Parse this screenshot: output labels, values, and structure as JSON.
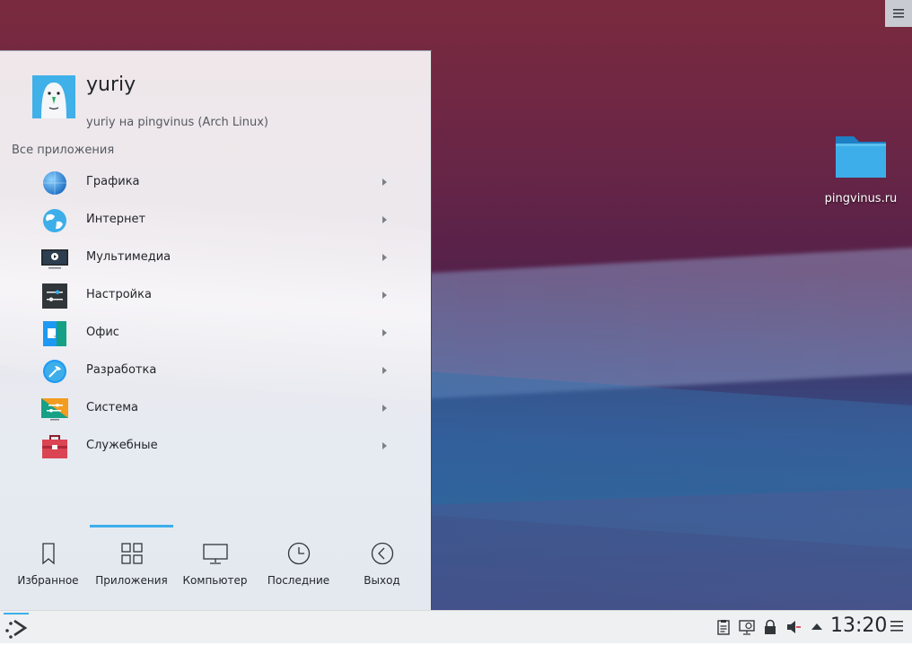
{
  "desktop": {
    "icons": [
      {
        "label": "pingvinus.ru",
        "icon": "folder-icon"
      }
    ],
    "toolbox_icon": "hamburger-menu-icon"
  },
  "launcher": {
    "user": {
      "name": "yuriy",
      "host": "yuriy на pingvinus (Arch Linux)"
    },
    "section_title": "Все приложения",
    "categories": [
      {
        "label": "Графика",
        "icon": "graphics-icon"
      },
      {
        "label": "Интернет",
        "icon": "internet-globe-icon"
      },
      {
        "label": "Мультимедиа",
        "icon": "multimedia-icon"
      },
      {
        "label": "Настройка",
        "icon": "settings-icon"
      },
      {
        "label": "Офис",
        "icon": "office-icon"
      },
      {
        "label": "Разработка",
        "icon": "development-icon"
      },
      {
        "label": "Система",
        "icon": "system-icon"
      },
      {
        "label": "Служебные",
        "icon": "utilities-toolbox-icon"
      }
    ],
    "tabs": [
      {
        "label": "Избранное",
        "icon": "bookmark-icon",
        "active": false
      },
      {
        "label": "Приложения",
        "icon": "grid-icon",
        "active": true
      },
      {
        "label": "Компьютер",
        "icon": "monitor-icon",
        "active": false
      },
      {
        "label": "Последние",
        "icon": "clock-icon",
        "active": false
      },
      {
        "label": "Выход",
        "icon": "back-arrow-icon",
        "active": false
      }
    ]
  },
  "panel": {
    "clock": "13:20",
    "tray": [
      "clipboard-icon",
      "display-config-icon",
      "lock-icon",
      "volume-muted-icon",
      "expand-tray-icon"
    ]
  },
  "colors": {
    "accent": "#3daee9",
    "text": "#232629",
    "panel_bg": "#eff0f1"
  }
}
